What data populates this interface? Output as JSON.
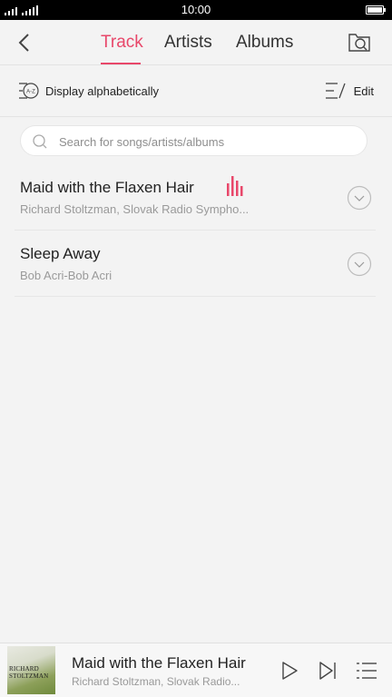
{
  "status_bar": {
    "time": "10:00"
  },
  "header": {
    "tabs": [
      {
        "label": "Track",
        "active": true
      },
      {
        "label": "Artists",
        "active": false
      },
      {
        "label": "Albums",
        "active": false
      }
    ]
  },
  "toolbar": {
    "sort_label": "Display alphabetically",
    "edit_label": "Edit"
  },
  "search": {
    "placeholder": "Search for songs/artists/albums"
  },
  "tracks": [
    {
      "title": "Maid with the Flaxen Hair",
      "subtitle": "Richard Stoltzman, Slovak Radio Sympho...",
      "playing": true
    },
    {
      "title": "Sleep Away",
      "subtitle": "Bob Acri-Bob Acri",
      "playing": false
    }
  ],
  "now_playing": {
    "title": "Maid with the Flaxen Hair",
    "subtitle": "Richard Stoltzman, Slovak Radio...",
    "cover_lines": [
      "RICHARD",
      "STOLTZMAN"
    ]
  },
  "colors": {
    "accent": "#e8476a",
    "background": "#f3f3f3",
    "status_bar": "#000000"
  }
}
